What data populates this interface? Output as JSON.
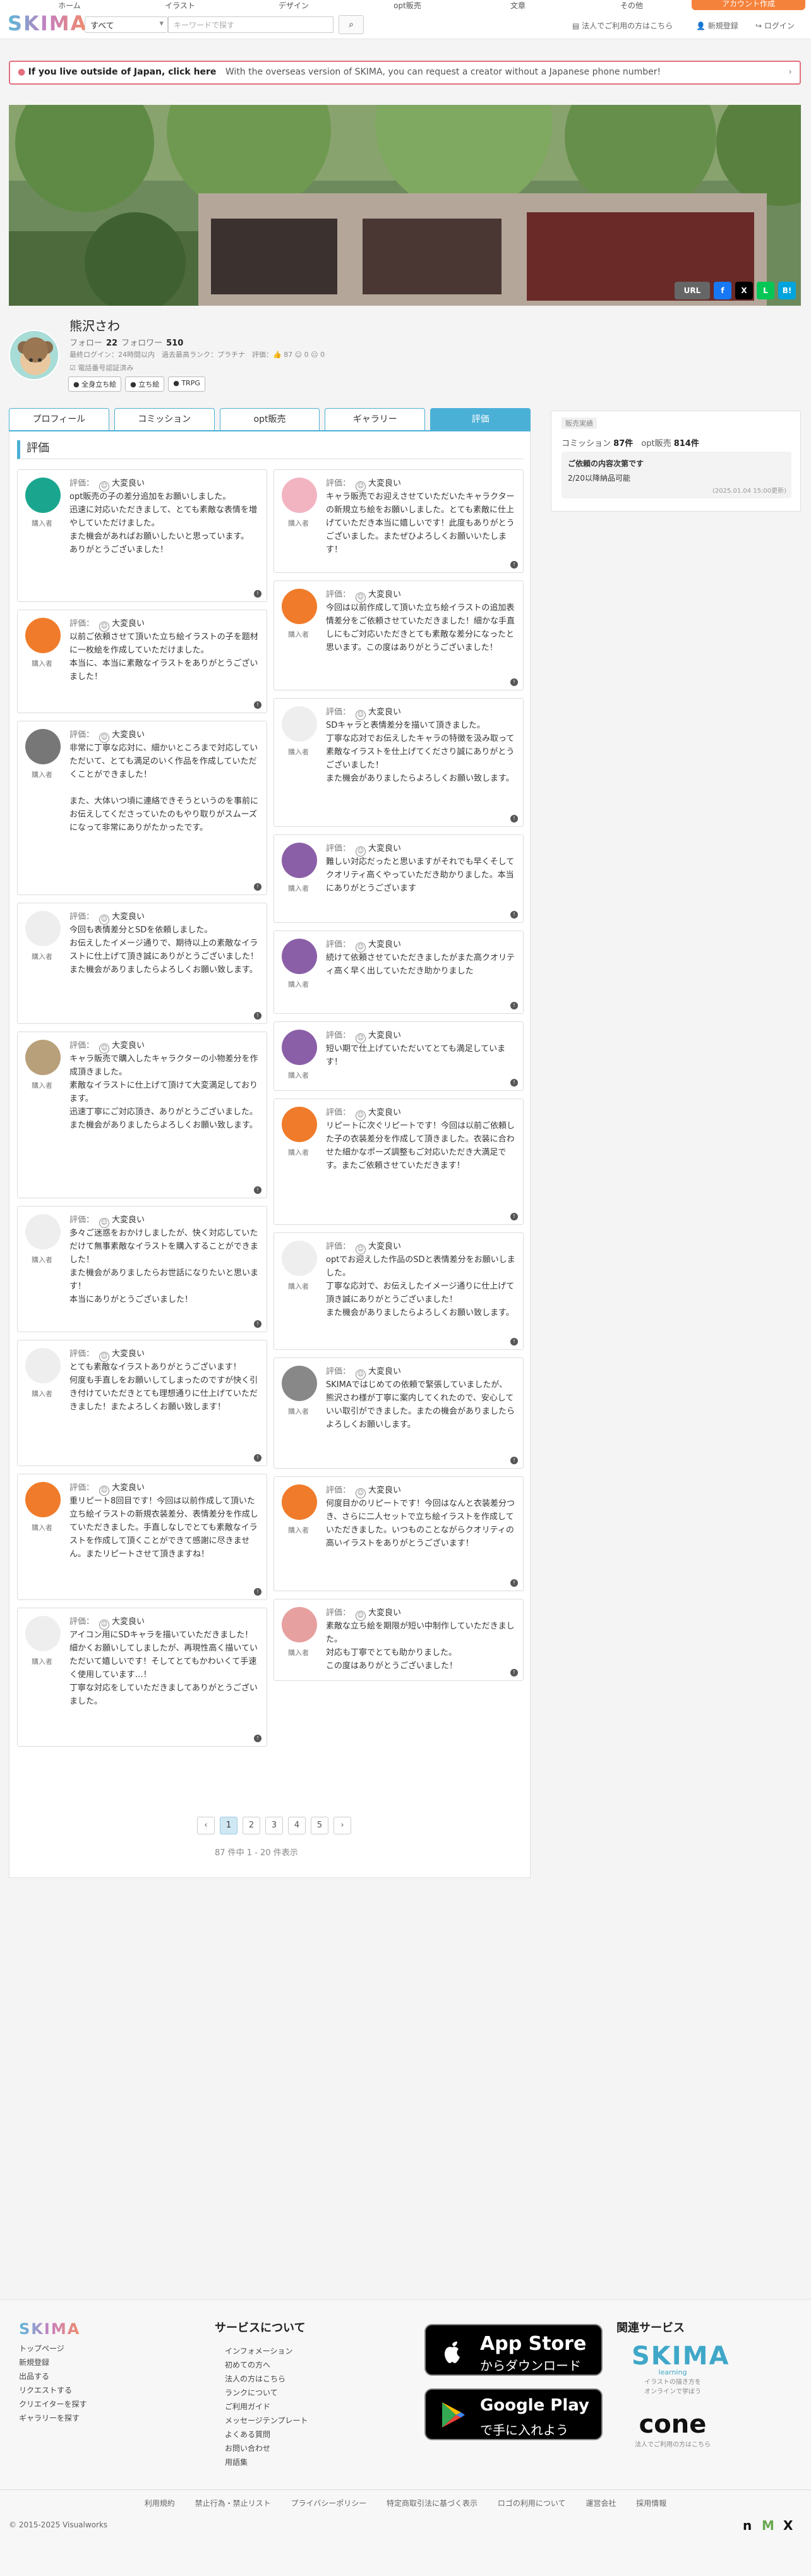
{
  "header": {
    "logo": "SKIMA",
    "categories": [
      "ホーム",
      "イラスト",
      "デザイン",
      "opt販売",
      "文章",
      "その他"
    ],
    "search_select": "すべて",
    "search_placeholder": "キーワードで探す",
    "search_icon": "search-icon",
    "overseas_link": "法人でご利用の方はこちら",
    "register_link": "新規登録",
    "login_link": "ログイン",
    "register_button": "アカウント作成"
  },
  "notice": {
    "title": "If you live outside of Japan, click here",
    "text": "With the overseas version of SKIMA, you can request a creator without a Japanese phone number!"
  },
  "share": {
    "url": "URL",
    "f": "f",
    "x": "X",
    "line": "L",
    "hatena": "B!"
  },
  "profile": {
    "name": "熊沢さわ",
    "follow_label": "フォロー",
    "follow_count": "22",
    "follower_label": "フォロワー",
    "follower_count": "510",
    "meta": "最終ログイン：24時間以内　過去最高ランク：プラチナ　評価：👍 87 ☺ 0 ☹ 0",
    "verified": "電話番号認証済み",
    "tags": [
      "全身立ち絵",
      "立ち絵",
      "TRPG"
    ]
  },
  "tabs": [
    "プロフィール",
    "コミッション",
    "opt販売",
    "ギャラリー",
    "評価"
  ],
  "active_tab": "評価",
  "section_title": "評価",
  "rating_prefix": "評価：",
  "rating_good": "大変良い",
  "role": "購入者",
  "reviews_left": [
    {
      "text": "opt販売の子の差分追加をお願いしました。\n迅速に対応いただきまして、とても素敵な表情を増やしていただけました。\nまた機会があればお願いしたいと思っています。\nありがとうございました！",
      "color": "#1aa68e"
    },
    {
      "text": "以前ご依頼させて頂いた立ち絵イラストの子を题材に一枚絵を作成していただけました。\n本当に、本当に素敵なイラストをありがとうございました！",
      "color": "#f07b2a"
    },
    {
      "text": "非常に丁寧な応対に、細かいところまで対応していただいて、とても満足のいく作品を作成していただくことができました！\n\nまた、大体いつ頃に連絡できそうというのを事前にお伝えしてくださっていたのもやり取りがスムーズになって非常にありがたかったです。",
      "color": "#777"
    },
    {
      "text": "今回も表情差分とSDを依頼しました。\nお伝えしたイメージ通りで、期待以上の素敵なイラストに仕上げて頂き誠にありがとうございました！\nまた機会がありましたらよろしくお願い致します。",
      "color": "#eee"
    },
    {
      "text": "キャラ販売で購入したキャラクターの小物差分を作成頂きました。\n素敵なイラストに仕上げて頂けて大変満足しております。\n迅速丁寧にご対応頂き、ありがとうございました。\nまた機会がありましたらよろしくお願い致します。",
      "color": "#b8a07a"
    },
    {
      "text": "多々ご迷惑をおかけしましたが、快く対応していただけて無事素敵なイラストを購入することができました！\nまた機会がありましたらお世話になりたいと思います！\n本当にありがとうございました！",
      "color": "#eee"
    },
    {
      "text": "とても素敵なイラストありがとうございます！\n何度も手直しをお願いしてしまったのですが快く引き付けていただきとても理想通りに仕上げていただきました！またよろしくお願い致します！",
      "color": "#eee"
    },
    {
      "text": "重リピート8回目です！今回は以前作成して頂いた立ち絵イラストの新規衣装差分、表情差分を作成していただきました。手直しなしでとても素敵なイラストを作成して頂くことができて感謝に尽きません。またリピートさせて頂きますね！",
      "color": "#f07b2a"
    },
    {
      "text": "アイコン用にSDキャラを描いていただきました！\n細かくお願いしてしましたが、再現性高く描いていただいて嬉しいです！そしてとてもかわいくて手速く使用しています…！\n丁寧な対応をしていただきましてありがとうございました。",
      "color": "#eee"
    }
  ],
  "reviews_right": [
    {
      "text": "キャラ販売でお迎えさせていただいたキャラクターの新規立ち絵をお願いしました。とても素敵に仕上げていただき本当に嬉しいです！此度もありがとうございました。またぜひよろしくお願いいたします！",
      "color": "#f3b4c2"
    },
    {
      "text": "今回は以前作成して頂いた立ち絵イラストの追加表情差分をご依頼させていただきました！細かな手直しにもご対応いただきとても素敵な差分になったと思います。この度はありがとうございました！",
      "color": "#f07b2a"
    },
    {
      "text": "SDキャラと表情差分を描いて頂きました。\n丁寧な応対でお伝えしたキャラの特徴を汲み取って素敵なイラストを仕上げてくださり誠にありがとうございました！\nまた機会がありましたらよろしくお願い致します。",
      "color": "#eee"
    },
    {
      "text": "難しい対応だったと思いますがそれでも早くそしてクオリティ高くやっていただき助かりました。本当にありがとうございます",
      "color": "#8b5fa8"
    },
    {
      "text": "続けて依頼させていただきましたがまた高クオリティ高く早く出していただき助かりました",
      "color": "#8b5fa8"
    },
    {
      "text": "短い期で仕上げていただいてとても満足しています！",
      "color": "#8b5fa8"
    },
    {
      "text": "リピートに次ぐリピートです！今回は以前ご依頼した子の衣装差分を作成して頂きました。衣装に合わせた細かなポーズ調整もご対応いただき大満足です。またご依頼させていただきます！",
      "color": "#f07b2a"
    },
    {
      "text": "optでお迎えした作品のSDと表情差分をお願いしました。\n丁寧な応対で、お伝えしたイメージ通りに仕上げて頂き誠にありがとうございました！\nまた機会がありましたらよろしくお願い致します。",
      "color": "#eee"
    },
    {
      "text": "SKIMAではじめての依頼で緊張していましたが、熊沢さわ様が丁寧に案内してくれたので、安心していい取引ができました。またの機会がありましたらよろしくお願いします。",
      "color": "#888"
    },
    {
      "text": "何度目かのリピートです！今回はなんと衣装差分つき、さらに二人セットで立ち絵イラストを作成していただきました。いつものことながらクオリティの高いイラストをありがとうございます！",
      "color": "#f07b2a"
    },
    {
      "text": "素敵な立ち絵を期限が短い中制作していただきました。\n対応も丁寧でとても助かりました。\nこの度はありがとうございました！",
      "color": "#e7a0a0"
    }
  ],
  "pagination": {
    "prev": "‹",
    "pages": [
      "1",
      "2",
      "3",
      "4",
      "5"
    ],
    "next": "›",
    "count": "87 件中 1 - 20 件表示"
  },
  "sidebar": {
    "label": "販売実績",
    "commission_label": "コミッション",
    "commission_count": "87件",
    "opt_label": "opt販売",
    "opt_count": "814件",
    "box_title": "ご依頼の内容次第です",
    "box_text": "2/20以降納品可能",
    "box_date": "(2025.01.04 15:00更新)"
  },
  "footer": {
    "logo": "SKIMA",
    "links": [
      "トップページ",
      "新規登録",
      "出品する",
      "リクエストする",
      "クリエイターを探す",
      "ギャラリーを探す"
    ],
    "service_title": "サービスについて",
    "service_links": [
      "インフォメーション",
      "初めての方へ",
      "法人の方はこちら",
      "ランクについて",
      "ご利用ガイド",
      "メッセージテンプレート",
      "よくある質問",
      "お問い合わせ",
      "用語集"
    ],
    "appstore_l1": "App Store",
    "appstore_l2": "からダウンロード",
    "googleplay_l1": "Google Play",
    "googleplay_l2": "で手に入れよう",
    "related_title": "関連サービス",
    "related1": "SKIMA",
    "related1_sub": "learning",
    "related1_desc": "イラストの描き方を\nオンラインで学ぼう",
    "related2": "cone",
    "related2_desc": "法人でご利用の方はこちら",
    "bottom_links": [
      "利用規約",
      "禁止行為・禁止リスト",
      "プライバシーポリシー",
      "特定商取引法に基づく表示",
      "ロゴの利用について",
      "運営会社",
      "採用情報"
    ],
    "copyright": "© 2015-2025 Visualworks"
  }
}
